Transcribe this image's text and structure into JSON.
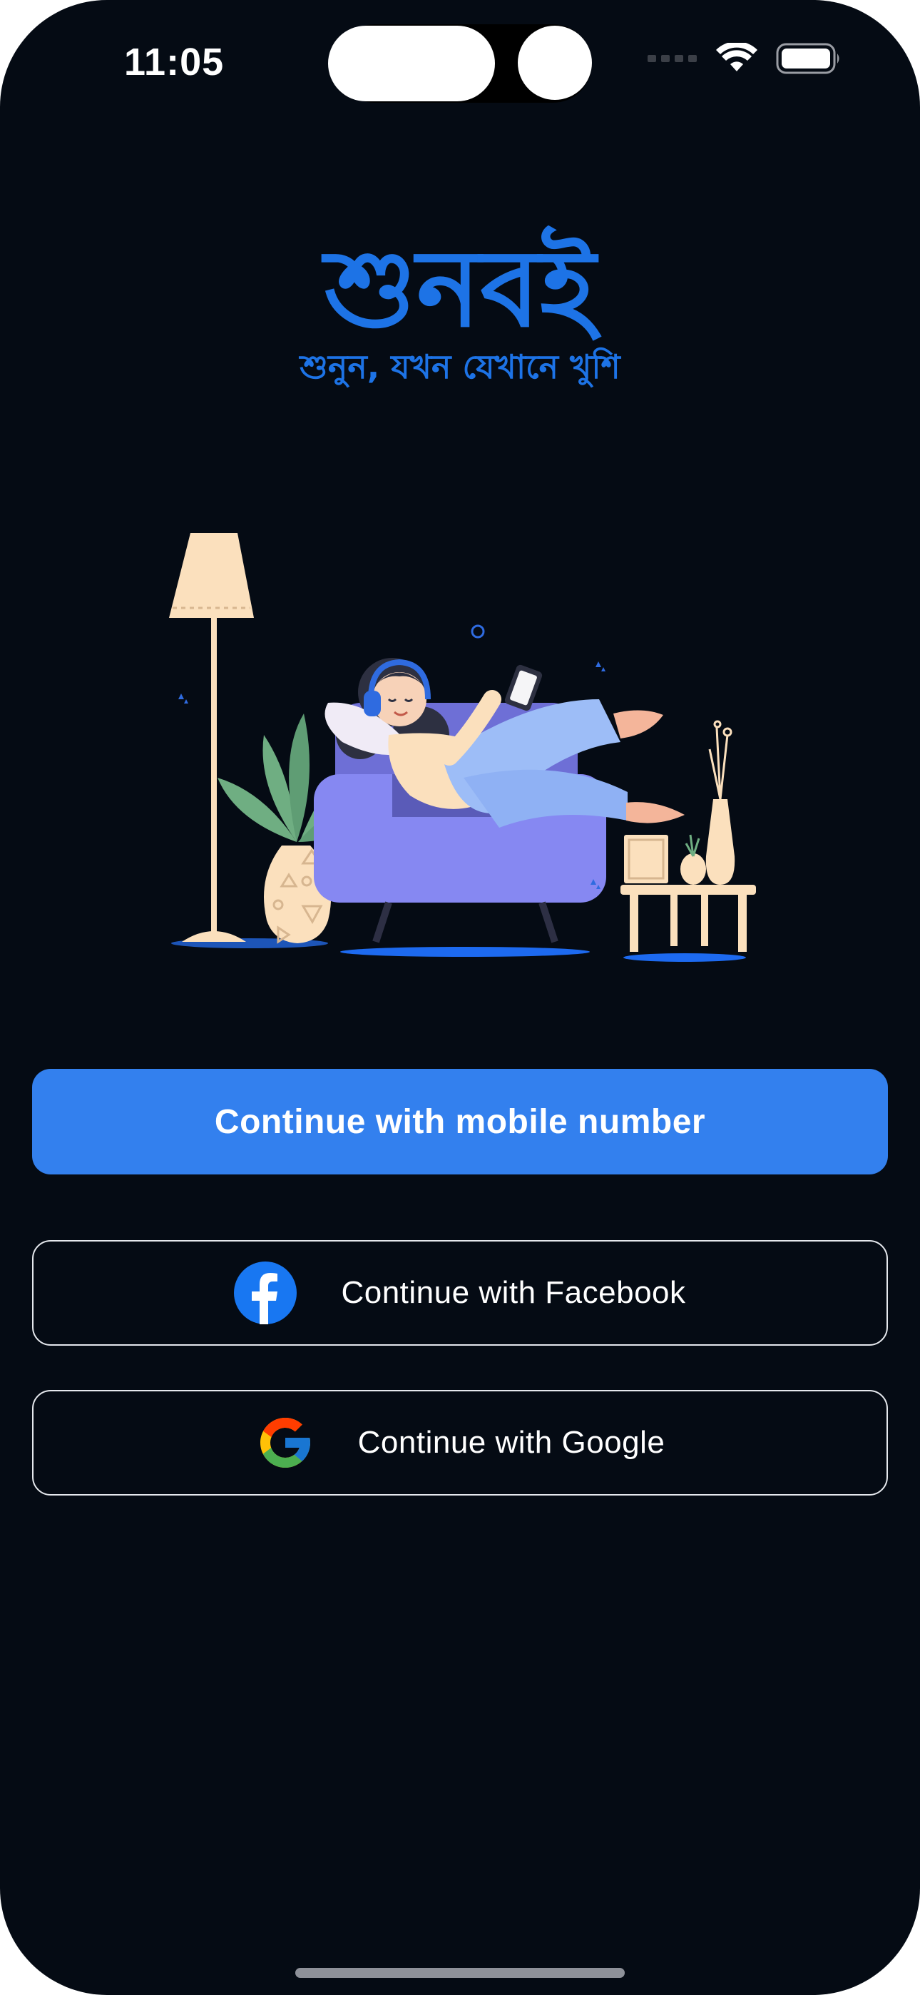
{
  "status_bar": {
    "time": "11:05"
  },
  "logo": {
    "title": "শুনবই",
    "tagline": "শুনুন, যখন যেখানে খুশি"
  },
  "buttons": {
    "mobile_label": "Continue with mobile number",
    "facebook_label": "Continue with Facebook",
    "google_label": "Continue with Google"
  },
  "icons": {
    "facebook": "facebook-icon",
    "google": "google-icon"
  },
  "colors": {
    "background": "#050b14",
    "brand_blue": "#1d73e6",
    "primary_button": "#3380ee",
    "facebook_blue": "#1877f2"
  }
}
